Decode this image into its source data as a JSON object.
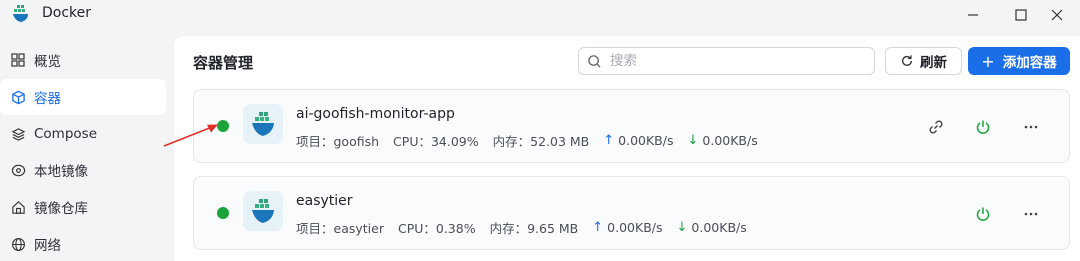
{
  "window": {
    "title": "Docker"
  },
  "sidebar": {
    "items": [
      {
        "label": "概览",
        "icon": "grid-icon"
      },
      {
        "label": "容器",
        "icon": "cube-icon"
      },
      {
        "label": "Compose",
        "icon": "layers-icon"
      },
      {
        "label": "本地镜像",
        "icon": "disc-icon"
      },
      {
        "label": "镜像仓库",
        "icon": "home-icon"
      },
      {
        "label": "网络",
        "icon": "globe-icon"
      }
    ],
    "active_index": 1
  },
  "main": {
    "title": "容器管理",
    "search": {
      "placeholder": "搜索",
      "value": ""
    },
    "refresh_label": "刷新",
    "add_label": "添加容器",
    "add_plus": "+"
  },
  "containers": [
    {
      "name": "ai-goofish-monitor-app",
      "status": "running",
      "project": "项目：goofish",
      "cpu": "CPU：34.09%",
      "mem": "内存：52.03 MB",
      "up": "0.00KB/s",
      "down": "0.00KB/s",
      "has_link": true
    },
    {
      "name": "easytier",
      "status": "running",
      "project": "项目：easytier",
      "cpu": "CPU：0.38%",
      "mem": "内存：9.65 MB",
      "up": "0.00KB/s",
      "down": "0.00KB/s",
      "has_link": false
    }
  ],
  "colors": {
    "accent": "#1a6ee8",
    "running": "#1aa43a",
    "annotation": "#e0302a"
  }
}
